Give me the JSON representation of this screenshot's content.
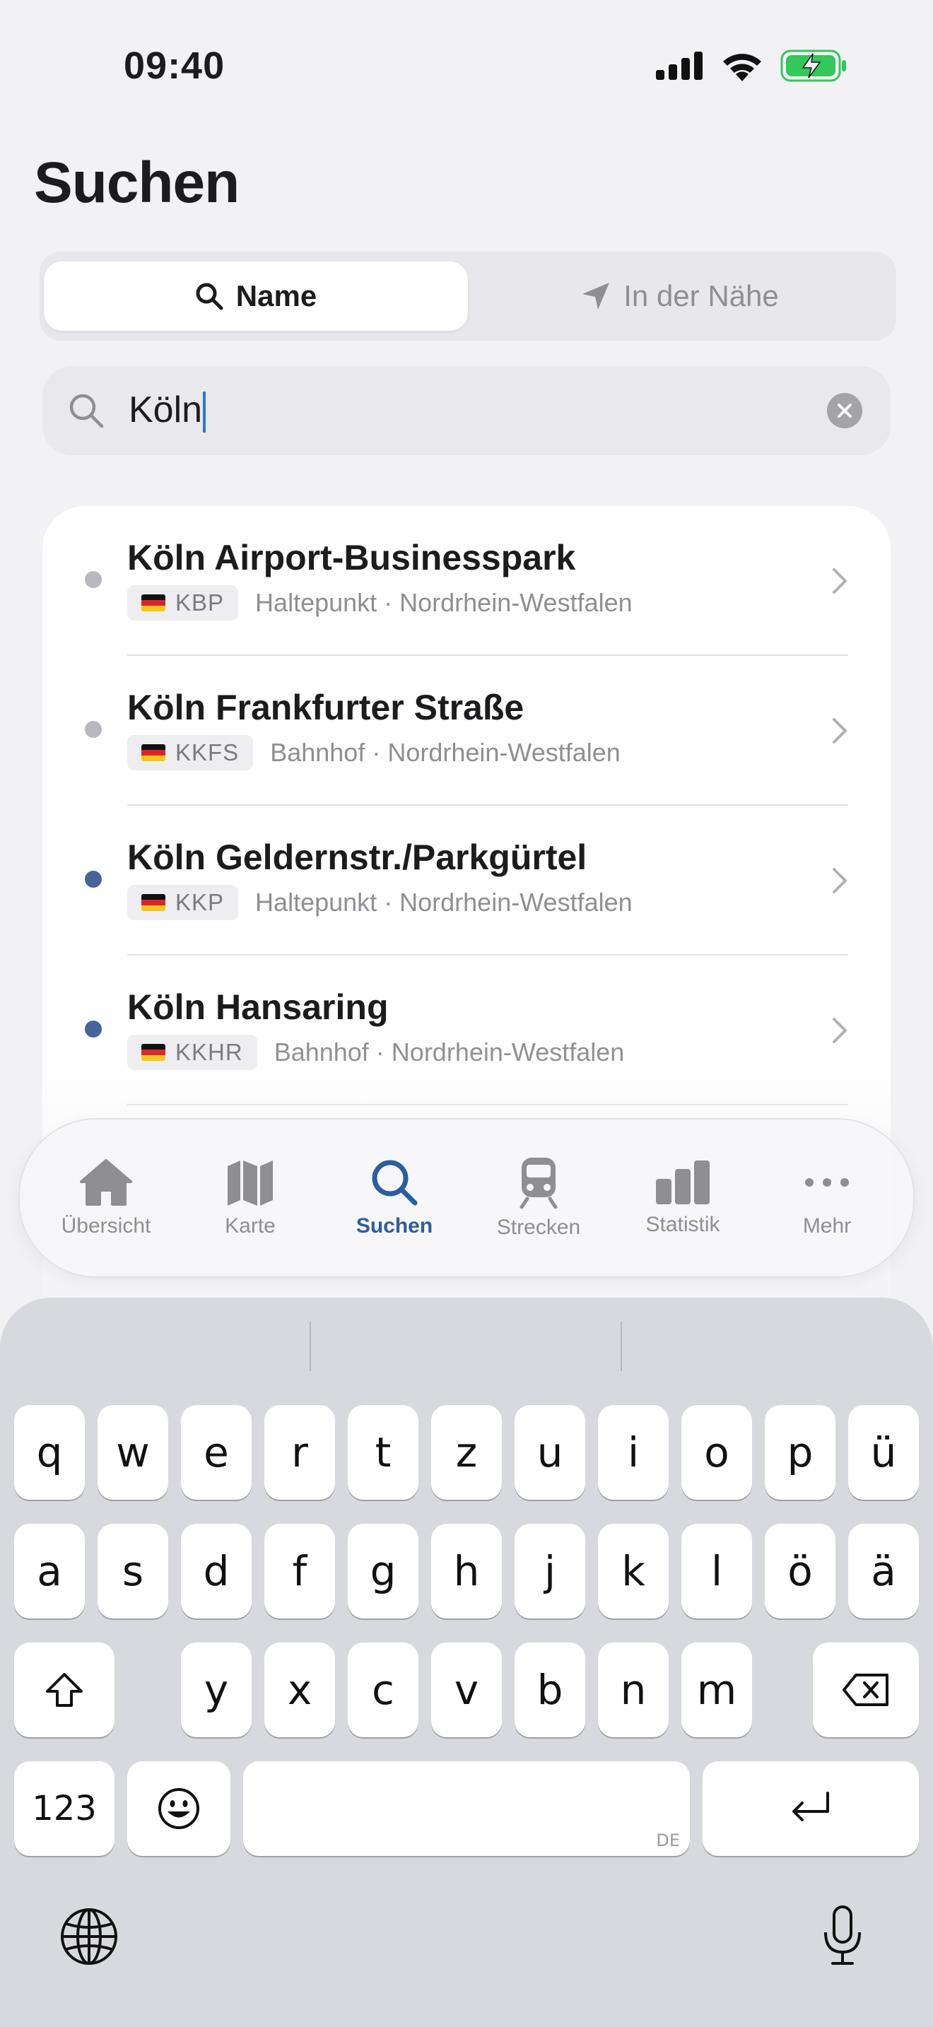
{
  "status_bar": {
    "time": "09:40"
  },
  "page": {
    "title": "Suchen"
  },
  "segmented": {
    "name_label": "Name",
    "nearby_label": "In der Nähe"
  },
  "search": {
    "value": "Köln"
  },
  "results": [
    {
      "name": "Köln Airport-Businesspark",
      "code": "KBP",
      "detail": "Haltepunkt · Nordrhein-Westfalen",
      "dot_color": "#b8b8be"
    },
    {
      "name": "Köln Frankfurter Straße",
      "code": "KKFS",
      "detail": "Bahnhof · Nordrhein-Westfalen",
      "dot_color": "#b8b8be"
    },
    {
      "name": "Köln Geldernstr./Parkgürtel",
      "code": "KKP",
      "detail": "Haltepunkt · Nordrhein-Westfalen",
      "dot_color": "#46649a"
    },
    {
      "name": "Köln Hansaring",
      "code": "KKHR",
      "detail": "Bahnhof · Nordrhein-Westfalen",
      "dot_color": "#46649a"
    }
  ],
  "tab_bar": {
    "tabs": [
      {
        "label": "Übersicht",
        "icon": "house-icon"
      },
      {
        "label": "Karte",
        "icon": "map-icon"
      },
      {
        "label": "Suchen",
        "icon": "search-icon"
      },
      {
        "label": "Strecken",
        "icon": "train-icon"
      },
      {
        "label": "Statistik",
        "icon": "chart-icon"
      },
      {
        "label": "Mehr",
        "icon": "ellipsis-icon"
      }
    ],
    "active_color": "#2c5e9c"
  },
  "keyboard": {
    "row1": [
      "q",
      "w",
      "e",
      "r",
      "t",
      "z",
      "u",
      "i",
      "o",
      "p",
      "ü"
    ],
    "row2": [
      "a",
      "s",
      "d",
      "f",
      "g",
      "h",
      "j",
      "k",
      "l",
      "ö",
      "ä"
    ],
    "row3": [
      "y",
      "x",
      "c",
      "v",
      "b",
      "n",
      "m"
    ],
    "numbers_label": "123",
    "space_lang": "DE"
  }
}
